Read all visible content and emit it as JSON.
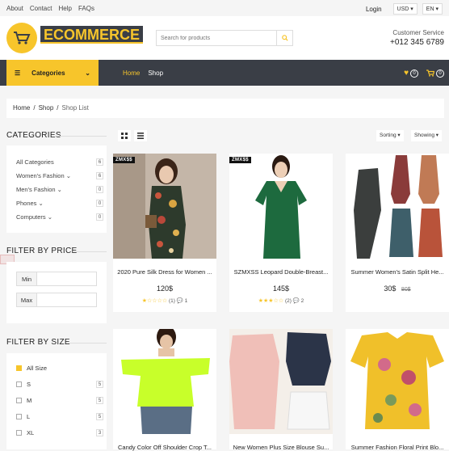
{
  "topbar": {
    "links": [
      "About",
      "Contact",
      "Help",
      "FAQs"
    ],
    "login": "Login",
    "currency": "USD",
    "language": "EN"
  },
  "header": {
    "logo_text": "ECOMMERCE",
    "search_placeholder": "Search for products",
    "service_label": "Customer Service",
    "phone": "+012 345 6789"
  },
  "nav": {
    "categories_label": "Categories",
    "links": [
      "Home",
      "Shop"
    ],
    "wishlist_count": "0",
    "cart_count": "0"
  },
  "breadcrumb": [
    "Home",
    "Shop",
    "Shop List"
  ],
  "sidebar": {
    "categories_title": "CATEGORIES",
    "categories": [
      {
        "label": "All Categories",
        "count": "6"
      },
      {
        "label": "Women's Fashion",
        "count": "6"
      },
      {
        "label": "Men's Fashion",
        "count": "0"
      },
      {
        "label": "Phones",
        "count": "0"
      },
      {
        "label": "Computers",
        "count": "0"
      }
    ],
    "price_title": "FILTER BY PRICE",
    "price_min_label": "Min",
    "price_max_label": "Max",
    "size_title": "FILTER BY SIZE",
    "sizes": [
      {
        "label": "All Size",
        "count": "",
        "checked": true
      },
      {
        "label": "S",
        "count": "5",
        "checked": false
      },
      {
        "label": "M",
        "count": "5",
        "checked": false
      },
      {
        "label": "L",
        "count": "5",
        "checked": false
      },
      {
        "label": "XL",
        "count": "3",
        "checked": false
      }
    ]
  },
  "toolbar": {
    "sorting_label": "Sorting",
    "showing_label": "Showing"
  },
  "products": [
    {
      "name": "2020 Pure Silk Dress for Women ...",
      "price": "120$",
      "old_price": "",
      "rating_count": "(1)",
      "comments": "1",
      "stars": 1.5,
      "brand_tag": "ZMX$$"
    },
    {
      "name": "SZMXSS Leopard Double-Breast...",
      "price": "145$",
      "old_price": "",
      "rating_count": "(2)",
      "comments": "2",
      "stars": 3,
      "brand_tag": "ZMX$$"
    },
    {
      "name": "Summer Women's Satin Split He...",
      "price": "30$",
      "old_price": "80$",
      "rating_count": "",
      "comments": "",
      "stars": 0,
      "brand_tag": ""
    },
    {
      "name": "Candy Color Off Shoulder Crop T...",
      "price": "",
      "old_price": "",
      "rating_count": "",
      "comments": "",
      "stars": 0,
      "brand_tag": ""
    },
    {
      "name": "New Women Plus Size Blouse Su...",
      "price": "",
      "old_price": "",
      "rating_count": "",
      "comments": "",
      "stars": 0,
      "brand_tag": ""
    },
    {
      "name": "Summer Fashion Floral Print Blo...",
      "price": "",
      "old_price": "",
      "rating_count": "",
      "comments": "",
      "stars": 0,
      "brand_tag": ""
    }
  ],
  "colors": {
    "accent": "#f7c52b",
    "dark": "#3a3e46"
  }
}
